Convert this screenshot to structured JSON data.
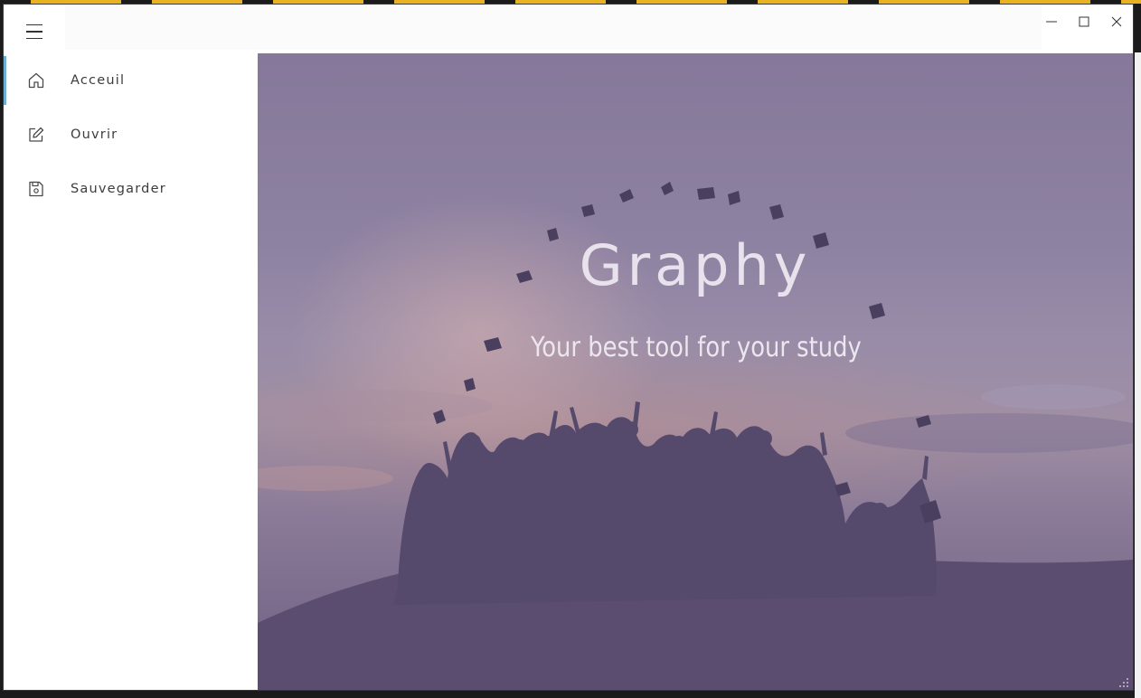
{
  "window": {
    "controls": {
      "minimize_icon": "minimize-icon",
      "maximize_icon": "maximize-icon",
      "close_icon": "close-icon"
    },
    "menu_icon": "hamburger-menu-icon"
  },
  "sidebar": {
    "items": [
      {
        "label": "Acceuil",
        "icon": "home-icon",
        "active": true
      },
      {
        "label": "Ouvrir",
        "icon": "edit-icon",
        "active": false
      },
      {
        "label": "Sauvegarder",
        "icon": "save-icon",
        "active": false
      }
    ],
    "accent_color": "#6fb0d6"
  },
  "hero": {
    "title": "Graphy",
    "subtitle": "Your best tool for your study",
    "background": "graduates-throwing-caps-silhouette"
  }
}
